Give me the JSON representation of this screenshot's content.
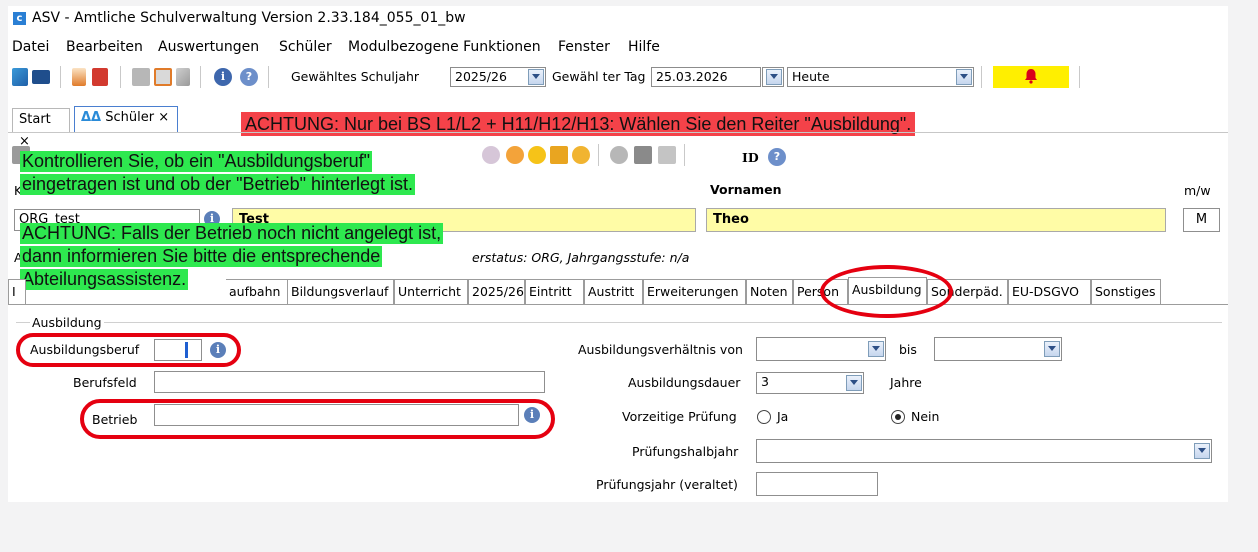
{
  "window": {
    "title": "ASV - Amtliche Schulverwaltung Version 2.33.184_055_01_bw",
    "app_icon": "asv-logo"
  },
  "menu": [
    "Datei",
    "Bearbeiten",
    "Auswertungen",
    "Schüler",
    "Modulbezogene Funktionen",
    "Fenster",
    "Hilfe"
  ],
  "toolbar": {
    "schuljahr_label": "Gewähltes Schuljahr",
    "schuljahr_value": "2025/26",
    "tag_label": "Gewähl ter Tag",
    "tag_value": "25.03.2026",
    "heute_value": "Heute",
    "id_label": "ID"
  },
  "doc_tabs": [
    {
      "label": "Start",
      "close": "×"
    },
    {
      "label": "Schüler",
      "close": "×"
    }
  ],
  "annotations": {
    "red_banner": "ACHTUNG: Nur bei BS L1/L2 + H11/H12/H13: Wählen Sie den Reiter \"Ausbildung\".",
    "green1_line1": "Kontrollieren Sie, ob ein \"Ausbildungsberuf\"",
    "green1_line2": "eingetragen ist und ob der \"Betrieb\" hinterlegt ist.",
    "green2_line1": "ACHTUNG: Falls der Betrieb noch nicht angelegt ist,",
    "green2_line2": "dann informieren Sie bitte die entsprechende",
    "green2_line3": "Abteilungsassistenz."
  },
  "student": {
    "klasse_label_partial": "K",
    "klasse_value": "ORG_test",
    "name_value": "Test",
    "vornamen_label": "Vornamen",
    "vornamen_value": "Theo",
    "mw_label": "m/w",
    "mw_value": "M",
    "status_line_partial": "erstatus: ORG, Jahrgangsstufe: n/a",
    "status_line_prefix": "A"
  },
  "subtabs": [
    "I",
    "aufbahn",
    "Bildungsverlauf",
    "Unterricht",
    "2025/26",
    "Eintritt",
    "Austritt",
    "Erweiterungen",
    "Noten",
    "Person",
    "Ausbildung",
    "Sonderpäd.",
    "EU-DSGVO",
    "Sonstiges"
  ],
  "ausbildung": {
    "group_label": "Ausbildung",
    "beruf_label": "Ausbildungsberuf",
    "beruf_value": "",
    "berufsfeld_label": "Berufsfeld",
    "berufsfeld_value": "",
    "betrieb_label": "Betrieb",
    "betrieb_value": "",
    "verhaeltnis_label": "Ausbildungsverhältnis von",
    "verhaeltnis_von": "",
    "bis_label": "bis",
    "verhaeltnis_bis": "",
    "dauer_label": "Ausbildungsdauer",
    "dauer_value": "3",
    "dauer_unit": "Jahre",
    "vorzeitig_label": "Vorzeitige Prüfung",
    "radio_ja": "Ja",
    "radio_nein": "Nein",
    "vorzeitig_selected": "Nein",
    "halbjahr_label": "Prüfungshalbjahr",
    "halbjahr_value": "",
    "pruefungsjahr_label": "Prüfungsjahr (veraltet)",
    "pruefungsjahr_value": ""
  },
  "colors": {
    "red_annotation": "#e50010",
    "green_highlight": "#2ee84f",
    "red_banner": "#f44249",
    "yellow_field": "#fffca6",
    "bell_box": "#ffef00"
  }
}
